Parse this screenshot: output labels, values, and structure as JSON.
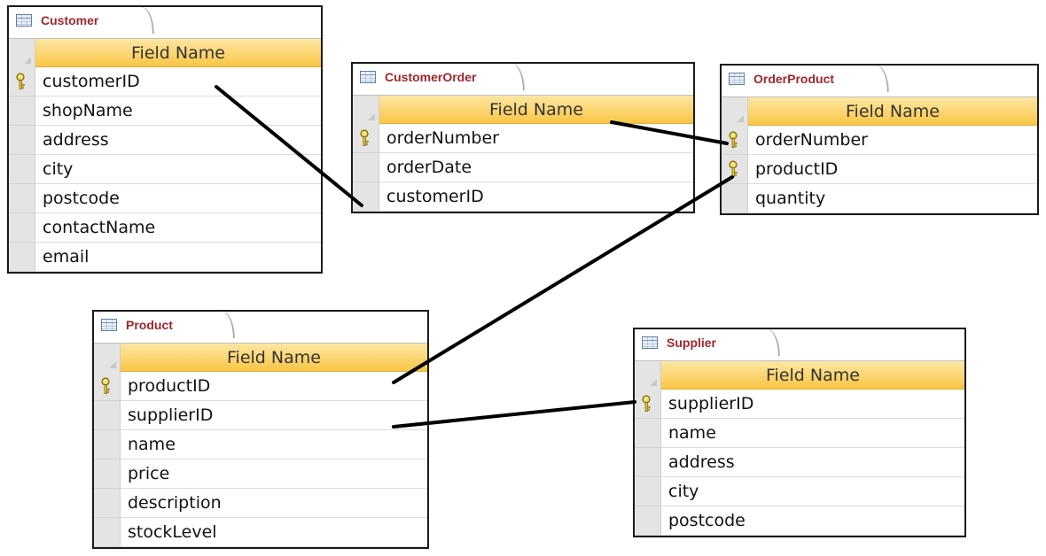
{
  "tables": {
    "customer": {
      "title": "Customer",
      "header": "Field Name",
      "fields": [
        {
          "name": "customerID",
          "key": true
        },
        {
          "name": "shopName",
          "key": false
        },
        {
          "name": "address",
          "key": false
        },
        {
          "name": "city",
          "key": false
        },
        {
          "name": "postcode",
          "key": false
        },
        {
          "name": "contactName",
          "key": false
        },
        {
          "name": "email",
          "key": false
        }
      ]
    },
    "customer_order": {
      "title": "CustomerOrder",
      "header": "Field Name",
      "fields": [
        {
          "name": "orderNumber",
          "key": true
        },
        {
          "name": "orderDate",
          "key": false
        },
        {
          "name": "customerID",
          "key": false
        }
      ]
    },
    "order_product": {
      "title": "OrderProduct",
      "header": "Field Name",
      "fields": [
        {
          "name": "orderNumber",
          "key": true
        },
        {
          "name": "productID",
          "key": true
        },
        {
          "name": "quantity",
          "key": false
        }
      ]
    },
    "product": {
      "title": "Product",
      "header": "Field Name",
      "fields": [
        {
          "name": "productID",
          "key": true
        },
        {
          "name": "supplierID",
          "key": false
        },
        {
          "name": "name",
          "key": false
        },
        {
          "name": "price",
          "key": false
        },
        {
          "name": "description",
          "key": false
        },
        {
          "name": "stockLevel",
          "key": false
        }
      ]
    },
    "supplier": {
      "title": "Supplier",
      "header": "Field Name",
      "fields": [
        {
          "name": "supplierID",
          "key": true
        },
        {
          "name": "name",
          "key": false
        },
        {
          "name": "address",
          "key": false
        },
        {
          "name": "city",
          "key": false
        },
        {
          "name": "postcode",
          "key": false
        }
      ]
    }
  },
  "colors": {
    "tab_title": "#a1262c",
    "header_fill": "#f9c645",
    "selector_fill": "#e4e4e4",
    "relationship_line": "#000000"
  }
}
